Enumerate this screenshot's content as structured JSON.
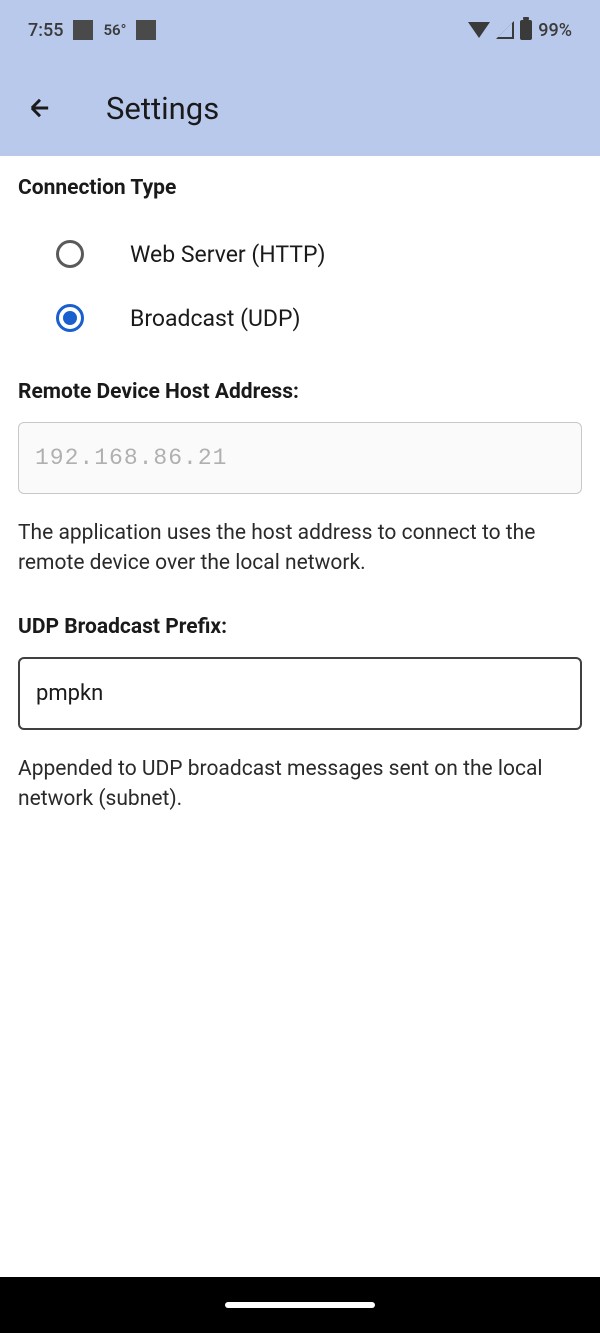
{
  "status": {
    "time": "7:55",
    "temperature": "56°",
    "battery": "99%"
  },
  "header": {
    "title": "Settings"
  },
  "connection": {
    "label": "Connection Type",
    "options": {
      "http": "Web Server (HTTP)",
      "udp": "Broadcast (UDP)"
    },
    "selected": "udp"
  },
  "host": {
    "label": "Remote Device Host Address:",
    "value": "192.168.86.21",
    "helper": "The application uses the host address to connect to the remote device over the local network."
  },
  "prefix": {
    "label": "UDP Broadcast Prefix:",
    "value": "pmpkn",
    "helper": "Appended to UDP broadcast messages sent on the local network (subnet)."
  }
}
